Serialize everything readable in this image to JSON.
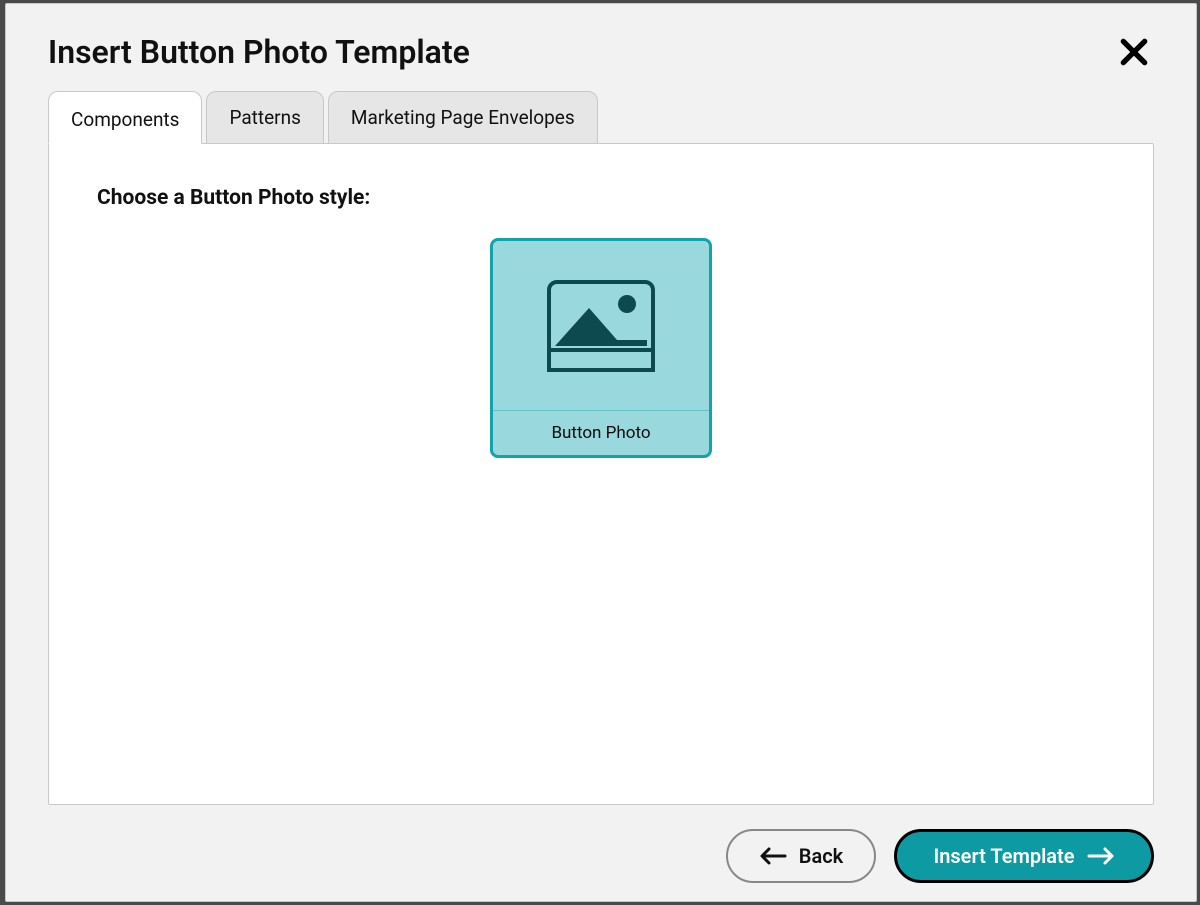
{
  "dialog": {
    "title": "Insert Button Photo Template"
  },
  "tabs": [
    {
      "label": "Components",
      "active": true
    },
    {
      "label": "Patterns",
      "active": false
    },
    {
      "label": "Marketing Page Envelopes",
      "active": false
    }
  ],
  "panel": {
    "choose_label": "Choose a Button Photo style:"
  },
  "styles": [
    {
      "label": "Button Photo",
      "icon": "image-icon",
      "selected": true
    }
  ],
  "footer": {
    "back_label": "Back",
    "insert_label": "Insert Template"
  }
}
